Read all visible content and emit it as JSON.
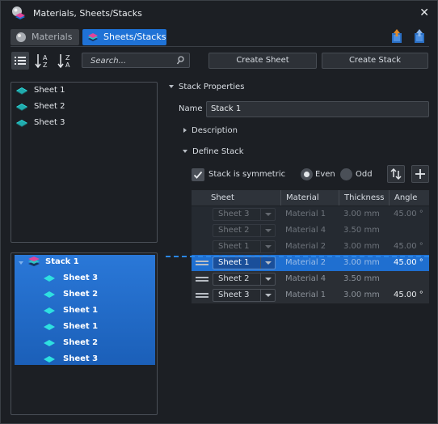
{
  "window": {
    "title": "Materials, Sheets/Stacks",
    "close_label": "✕"
  },
  "tabs": [
    {
      "label": "Materials",
      "active": false
    },
    {
      "label": "Sheets/Stacks",
      "active": true
    }
  ],
  "toolbar": {
    "search_placeholder": "Search...",
    "create_sheet_label": "Create Sheet",
    "create_stack_label": "Create Stack",
    "sort_az": "AZ",
    "sort_za": "ZA"
  },
  "sheets_list": [
    "Sheet 1",
    "Sheet 2",
    "Sheet 3"
  ],
  "stacks_tree": {
    "stack_label": "Stack 1",
    "children": [
      "Sheet 3",
      "Sheet 2",
      "Sheet 1",
      "Sheet 1",
      "Sheet 2",
      "Sheet 3"
    ]
  },
  "properties": {
    "header": "Stack Properties",
    "name_label": "Name",
    "name_value": "Stack 1",
    "description_label": "Description",
    "define_stack_label": "Define Stack",
    "symmetric_label": "Stack is symmetric",
    "symmetric_checked": true,
    "even_label": "Even",
    "odd_label": "Odd",
    "parity_selected": "Even"
  },
  "stack_table": {
    "columns": [
      "Sheet",
      "Material",
      "Thickness",
      "Angle"
    ],
    "rows": [
      {
        "sheet": "Sheet 3",
        "material": "Material 1",
        "thickness": "3.00 mm",
        "angle": "45.00 °",
        "state": "ghost"
      },
      {
        "sheet": "Sheet 2",
        "material": "Material 4",
        "thickness": "3.50 mm",
        "angle": "",
        "state": "ghost"
      },
      {
        "sheet": "Sheet 1",
        "material": "Material 2",
        "thickness": "3.00 mm",
        "angle": "45.00 °",
        "state": "ghost"
      },
      {
        "sheet": "Sheet 1",
        "material": "Material 2",
        "thickness": "3.00 mm",
        "angle": "45.00 °",
        "state": "selected"
      },
      {
        "sheet": "Sheet 2",
        "material": "Material 4",
        "thickness": "3.50 mm",
        "angle": "",
        "state": "normal"
      },
      {
        "sheet": "Sheet 3",
        "material": "Material 1",
        "thickness": "3.00 mm",
        "angle": "45.00 °",
        "state": "normal"
      }
    ]
  },
  "colors": {
    "accent": "#1f72d6",
    "drop_indicator": "#2a86e6",
    "background": "#1c1f24"
  }
}
